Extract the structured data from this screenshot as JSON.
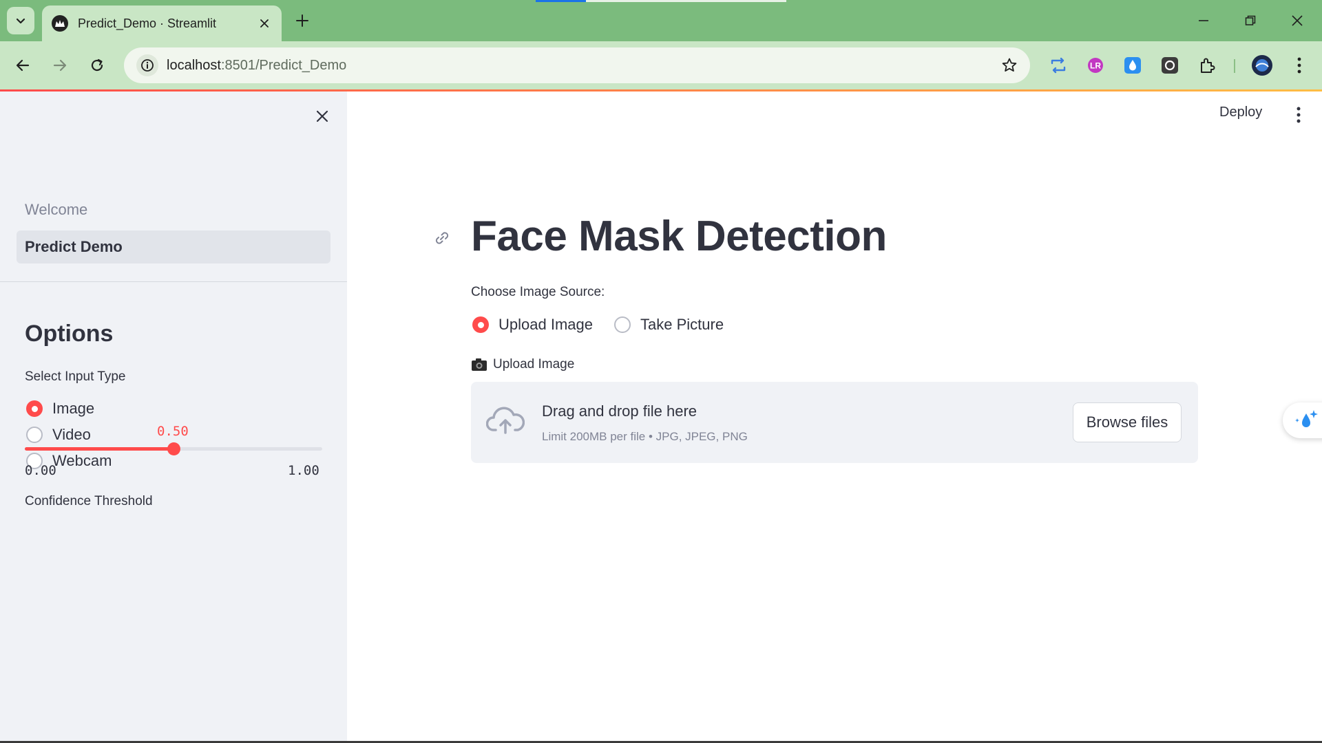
{
  "browser": {
    "tab_title": "Predict_Demo · Streamlit",
    "url_host": "localhost",
    "url_path": ":8501/Predict_Demo"
  },
  "sidebar": {
    "nav": [
      {
        "label": "Welcome",
        "active": false
      },
      {
        "label": "Predict Demo",
        "active": true
      }
    ],
    "options_heading": "Options",
    "input_type_label": "Select Input Type",
    "input_types": [
      {
        "label": "Image",
        "selected": true
      },
      {
        "label": "Video",
        "selected": false
      },
      {
        "label": "Webcam",
        "selected": false
      }
    ],
    "confidence": {
      "label": "Confidence Threshold",
      "value": "0.50",
      "min": "0.00",
      "max": "1.00",
      "fraction": 0.5
    }
  },
  "main": {
    "deploy_label": "Deploy",
    "title": "Face Mask Detection",
    "source_label": "Choose Image Source:",
    "sources": [
      {
        "label": "Upload Image",
        "selected": true
      },
      {
        "label": "Take Picture",
        "selected": false
      }
    ],
    "upload_label": "Upload Image",
    "dropzone": {
      "main_text": "Drag and drop file here",
      "sub_text": "Limit 200MB per file • JPG, JPEG, PNG",
      "button_label": "Browse files"
    }
  },
  "colors": {
    "accent": "#ff4b4b",
    "sidebar_bg": "#f0f2f6",
    "chrome_frame": "#7bbb7d",
    "chrome_toolbar": "#c9e6c5",
    "text": "#31333f"
  },
  "icons": [
    "tab-search-icon",
    "streamlit-logo-icon",
    "close-icon",
    "plus-icon",
    "minimize-icon",
    "restore-icon",
    "back-icon",
    "forward-icon",
    "reload-icon",
    "site-info-icon",
    "star-icon",
    "extensions-icon",
    "profile-avatar",
    "more-icon",
    "link-icon",
    "camera-icon",
    "cloud-upload-icon",
    "sparkle-drop-icon"
  ]
}
